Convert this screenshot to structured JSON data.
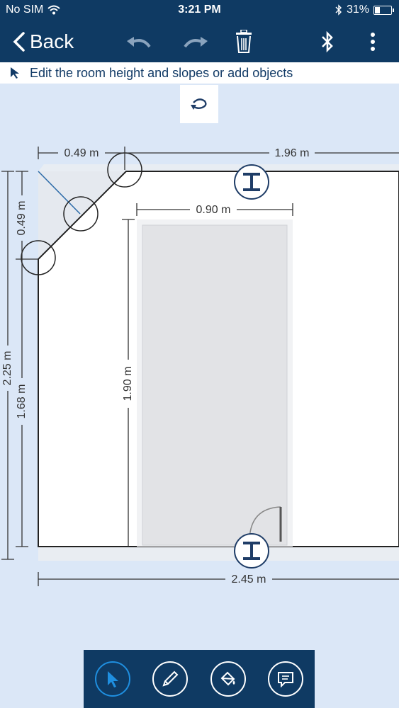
{
  "status_bar": {
    "carrier": "No SIM",
    "time": "3:21 PM",
    "battery": "31%",
    "battery_level": 0.31
  },
  "nav": {
    "back_label": "Back",
    "icons": [
      "undo-icon",
      "redo-icon",
      "trash-icon",
      "bluetooth-icon",
      "more-icon"
    ]
  },
  "hint": {
    "text": "Edit the room height and slopes or add objects"
  },
  "dimensions": {
    "top_left": "0.49 m",
    "top_right": "1.96 m",
    "left_upper": "0.49 m",
    "left_total": "2.25 m",
    "left_lower": "1.68 m",
    "object_width": "0.90 m",
    "object_height": "1.90 m",
    "bottom": "2.45 m"
  },
  "colors": {
    "bar": "#0f3a63",
    "accent": "#1f8fe0",
    "background": "#dbe7f7",
    "wall": "#222222"
  },
  "toolbar": {
    "tools": [
      "select-icon",
      "pencil-icon",
      "paint-bucket-icon",
      "comment-icon"
    ]
  }
}
